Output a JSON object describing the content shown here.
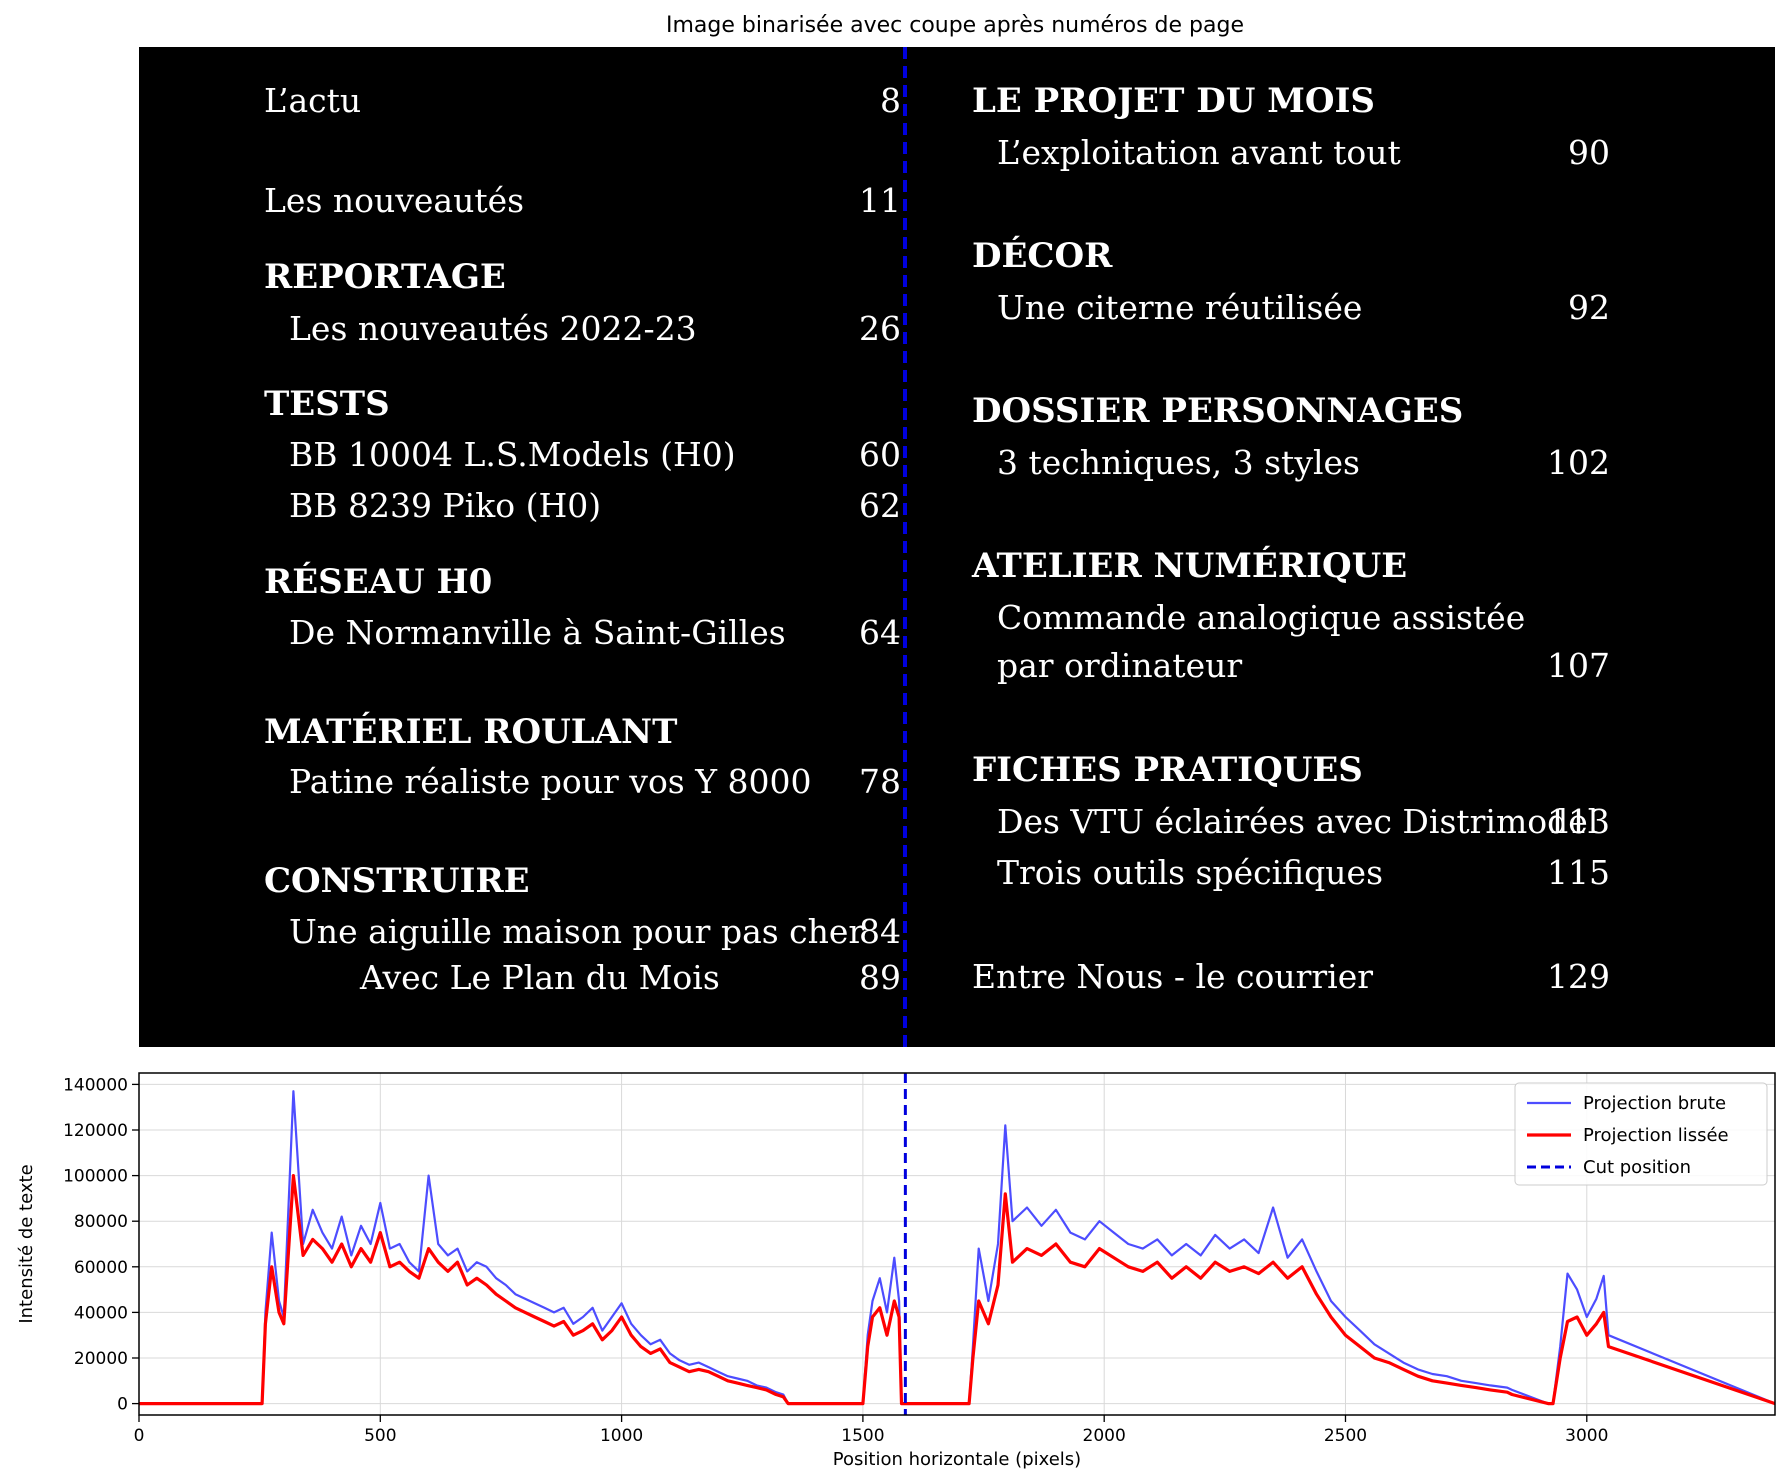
{
  "title": "Image binarisée avec coupe après numéros de page",
  "colors": {
    "background_image": "#000000",
    "text": "#ffffff",
    "raw": "#4d4dff",
    "smooth": "#ff0000",
    "cut": "#0000dd"
  },
  "toc": {
    "left": [
      {
        "type": "entry",
        "indent": 0,
        "text": "L’actu",
        "page": "8"
      },
      {
        "type": "entry",
        "indent": 0,
        "text": "Les nouveautés",
        "page": "11"
      },
      {
        "type": "heading",
        "text": "REPORTAGE"
      },
      {
        "type": "entry",
        "indent": 1,
        "text": "Les nouveautés 2022-23",
        "page": "26"
      },
      {
        "type": "heading",
        "text": "TESTS"
      },
      {
        "type": "entry",
        "indent": 1,
        "text": "BB 10004 L.S.Models (H0)",
        "page": "60"
      },
      {
        "type": "entry",
        "indent": 1,
        "text": "BB 8239 Piko (H0)",
        "page": "62"
      },
      {
        "type": "heading",
        "text": "RÉSEAU H0"
      },
      {
        "type": "entry",
        "indent": 1,
        "text": "De Normanville à Saint-Gilles",
        "page": "64"
      },
      {
        "type": "heading",
        "text": "MATÉRIEL ROULANT"
      },
      {
        "type": "entry",
        "indent": 1,
        "text": "Patine réaliste pour vos Y 8000",
        "page": "78"
      },
      {
        "type": "heading",
        "text": "CONSTRUIRE"
      },
      {
        "type": "entry",
        "indent": 1,
        "text": "Une aiguille maison pour pas cher",
        "page": "84"
      },
      {
        "type": "entry",
        "indent": 2,
        "text": "Avec Le Plan du Mois",
        "page": "89"
      }
    ],
    "right": [
      {
        "type": "heading",
        "text": "LE PROJET DU MOIS"
      },
      {
        "type": "entry",
        "indent": 1,
        "text": "L’exploitation avant tout",
        "page": "90"
      },
      {
        "type": "heading",
        "text": "DÉCOR"
      },
      {
        "type": "entry",
        "indent": 1,
        "text": "Une citerne réutilisée",
        "page": "92"
      },
      {
        "type": "heading",
        "text": "DOSSIER PERSONNAGES"
      },
      {
        "type": "entry",
        "indent": 1,
        "text": "3 techniques, 3 styles",
        "page": "102"
      },
      {
        "type": "heading",
        "text": "ATELIER NUMÉRIQUE"
      },
      {
        "type": "entry",
        "indent": 1,
        "text": "Commande analogique assistée",
        "page": ""
      },
      {
        "type": "entry",
        "indent": 1,
        "text": "par ordinateur",
        "page": "107"
      },
      {
        "type": "heading",
        "text": "FICHES PRATIQUES"
      },
      {
        "type": "entry",
        "indent": 1,
        "text": "Des VTU éclairées avec Distrimodel",
        "page": "113"
      },
      {
        "type": "entry",
        "indent": 1,
        "text": "Trois outils spécifiques",
        "page": "115"
      },
      {
        "type": "entry",
        "indent": 0,
        "text": "Entre Nous - le courrier",
        "page": "129"
      }
    ]
  },
  "chart_data": {
    "type": "line",
    "xlabel": "Position horizontale (pixels)",
    "ylabel": "Intensité de texte",
    "xlim": [
      0,
      3390
    ],
    "ylim": [
      -5000,
      145000
    ],
    "xticks": [
      0,
      500,
      1000,
      1500,
      2000,
      2500,
      3000
    ],
    "yticks": [
      0,
      20000,
      40000,
      60000,
      80000,
      100000,
      120000,
      140000
    ],
    "grid": true,
    "legend_position": "top-right",
    "cut_position": 1588,
    "series": [
      {
        "name": "Projection brute",
        "style": "raw"
      },
      {
        "name": "Projection lissée",
        "style": "smooth"
      },
      {
        "name": "Cut position",
        "style": "cut"
      }
    ],
    "profile": {
      "x": [
        0,
        255,
        262,
        275,
        290,
        300,
        320,
        340,
        360,
        380,
        400,
        420,
        440,
        460,
        480,
        500,
        520,
        540,
        560,
        580,
        600,
        620,
        640,
        660,
        680,
        700,
        720,
        740,
        760,
        780,
        800,
        820,
        840,
        860,
        880,
        900,
        920,
        940,
        960,
        980,
        1000,
        1020,
        1040,
        1060,
        1080,
        1100,
        1120,
        1140,
        1160,
        1180,
        1200,
        1220,
        1240,
        1260,
        1280,
        1300,
        1320,
        1335,
        1345,
        1500,
        1510,
        1520,
        1535,
        1550,
        1565,
        1575,
        1580,
        1720,
        1728,
        1740,
        1760,
        1780,
        1795,
        1810,
        1840,
        1870,
        1900,
        1930,
        1960,
        1990,
        2020,
        2050,
        2080,
        2110,
        2140,
        2170,
        2200,
        2230,
        2260,
        2290,
        2320,
        2350,
        2380,
        2410,
        2440,
        2470,
        2500,
        2530,
        2560,
        2590,
        2620,
        2650,
        2680,
        2710,
        2740,
        2770,
        2800,
        2835,
        2845,
        2920,
        2930,
        2945,
        2960,
        2980,
        3000,
        3020,
        3035,
        3045,
        3390
      ],
      "smooth": [
        0,
        0,
        35000,
        60000,
        40000,
        35000,
        100000,
        65000,
        72000,
        68000,
        62000,
        70000,
        60000,
        68000,
        62000,
        75000,
        60000,
        62000,
        58000,
        55000,
        68000,
        62000,
        58000,
        62000,
        52000,
        55000,
        52000,
        48000,
        45000,
        42000,
        40000,
        38000,
        36000,
        34000,
        36000,
        30000,
        32000,
        35000,
        28000,
        32000,
        38000,
        30000,
        25000,
        22000,
        24000,
        18000,
        16000,
        14000,
        15000,
        14000,
        12000,
        10000,
        9000,
        8000,
        7000,
        6000,
        4000,
        3000,
        0,
        0,
        25000,
        38000,
        42000,
        30000,
        45000,
        38000,
        0,
        0,
        20000,
        45000,
        35000,
        52000,
        92000,
        62000,
        68000,
        65000,
        70000,
        62000,
        60000,
        68000,
        64000,
        60000,
        58000,
        62000,
        55000,
        60000,
        55000,
        62000,
        58000,
        60000,
        57000,
        62000,
        55000,
        60000,
        48000,
        38000,
        30000,
        25000,
        20000,
        18000,
        15000,
        12000,
        10000,
        9000,
        8000,
        7000,
        6000,
        5000,
        4000,
        0,
        0,
        20000,
        36000,
        38000,
        30000,
        35000,
        40000,
        25000,
        0,
        0
      ],
      "raw": [
        0,
        0,
        40000,
        75000,
        45000,
        38000,
        137000,
        70000,
        85000,
        75000,
        68000,
        82000,
        65000,
        78000,
        70000,
        88000,
        68000,
        70000,
        62000,
        58000,
        100000,
        70000,
        65000,
        68000,
        58000,
        62000,
        60000,
        55000,
        52000,
        48000,
        46000,
        44000,
        42000,
        40000,
        42000,
        35000,
        38000,
        42000,
        32000,
        38000,
        44000,
        35000,
        30000,
        26000,
        28000,
        22000,
        19000,
        17000,
        18000,
        16000,
        14000,
        12000,
        11000,
        10000,
        8000,
        7000,
        5000,
        4000,
        0,
        0,
        30000,
        45000,
        55000,
        40000,
        64000,
        45000,
        0,
        0,
        25000,
        68000,
        45000,
        70000,
        122000,
        80000,
        86000,
        78000,
        85000,
        75000,
        72000,
        80000,
        75000,
        70000,
        68000,
        72000,
        65000,
        70000,
        65000,
        74000,
        68000,
        72000,
        66000,
        86000,
        64000,
        72000,
        58000,
        45000,
        38000,
        32000,
        26000,
        22000,
        18000,
        15000,
        13000,
        12000,
        10000,
        9000,
        8000,
        7000,
        6000,
        0,
        0,
        25000,
        57000,
        50000,
        38000,
        46000,
        56000,
        30000,
        0,
        0
      ]
    }
  }
}
